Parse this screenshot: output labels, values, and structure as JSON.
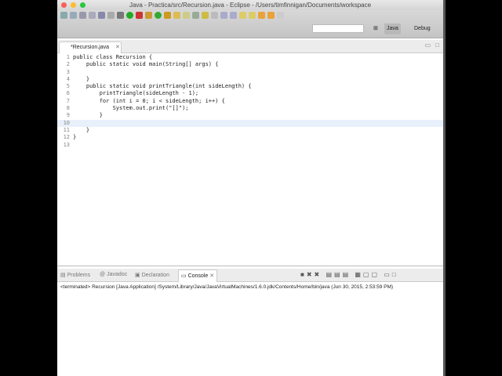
{
  "window": {
    "title": "Java - Practica/src/Recursion.java - Eclipse - /Users/timfinnigan/Documents/workspace"
  },
  "perspectives": [
    {
      "label": "Java"
    },
    {
      "label": "Debug"
    }
  ],
  "editor": {
    "tab_label": "*Recursion.java",
    "lines": [
      {
        "n": "1",
        "code": "public class Recursion {"
      },
      {
        "n": "2",
        "code": "    public static void main(String[] args) {"
      },
      {
        "n": "3",
        "code": ""
      },
      {
        "n": "4",
        "code": "    }"
      },
      {
        "n": "5",
        "code": "    public static void printTriangle(int sideLength) {"
      },
      {
        "n": "6",
        "code": "        printTriangle(sideLength - 1);"
      },
      {
        "n": "7",
        "code": "        for (int i = 0; i < sideLength; i++) {"
      },
      {
        "n": "8",
        "code": "            System.out.print(\"[]\");"
      },
      {
        "n": "9",
        "code": "        }"
      },
      {
        "n": "10",
        "code": ""
      },
      {
        "n": "11",
        "code": "    }"
      },
      {
        "n": "12",
        "code": "}"
      },
      {
        "n": "13",
        "code": ""
      }
    ]
  },
  "bottom_tabs": [
    {
      "label": "Problems"
    },
    {
      "label": "Javadoc"
    },
    {
      "label": "Declaration"
    },
    {
      "label": "Console"
    }
  ],
  "console": {
    "status": "<terminated> Recursion [Java Application] /System/Library/Java/JavaVirtualMachines/1.6.0.jdk/Contents/Home/bin/java (Jun 30, 2015, 2:53:59 PM)"
  }
}
